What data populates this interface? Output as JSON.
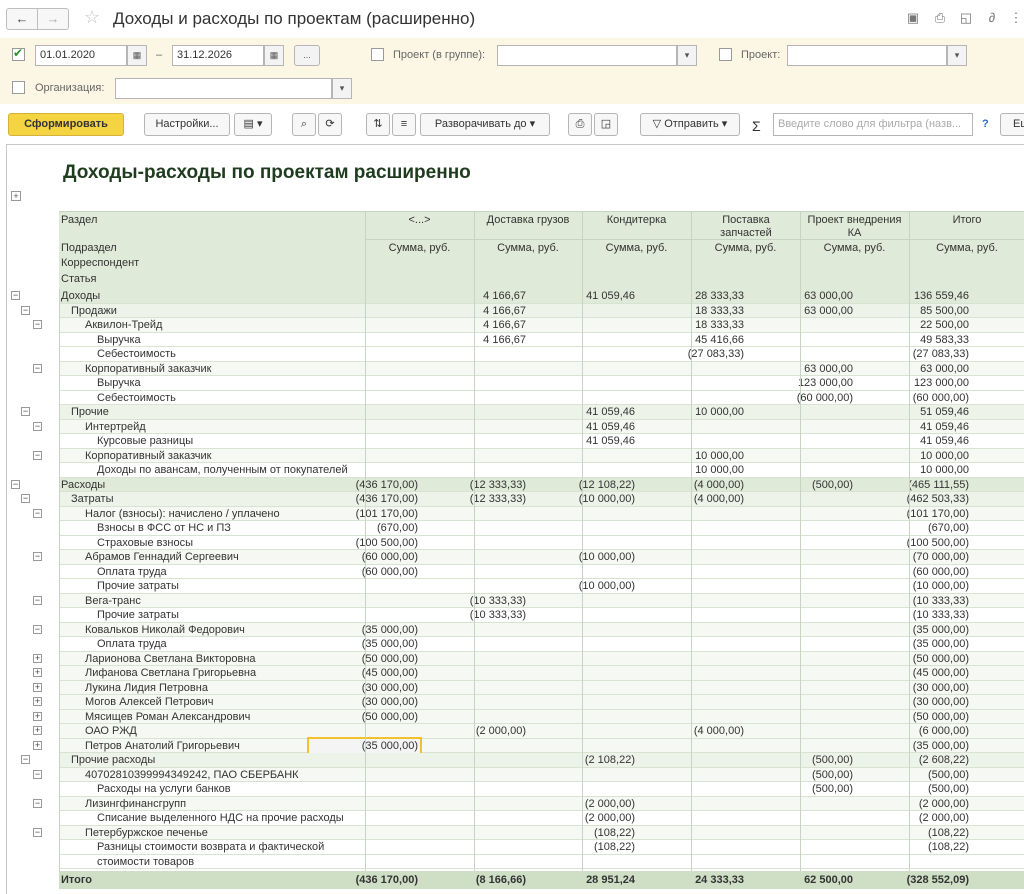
{
  "window": {
    "title": "Доходы и расходы по проектам (расширенно)"
  },
  "filters": {
    "period_from": "01.01.2020",
    "period_sep": "–",
    "period_to": "31.12.2026",
    "more_btn": "...",
    "project_group_label": "Проект (в группе):",
    "project_label": "Проект:",
    "org_label": "Организация:"
  },
  "toolbar": {
    "generate": "Сформировать",
    "settings": "Настройки...",
    "expand_to": "Разворачивать до",
    "send": "Отправить",
    "sigma": "Σ",
    "search_placeholder": "Введите слово для фильтра (назв...",
    "help": "?",
    "more": "Еще"
  },
  "report": {
    "title": "Доходы-расходы по проектам расширенно",
    "headers": {
      "row1": [
        "Раздел",
        "<...>",
        "Доставка грузов",
        "Кондитерка",
        "Поставка запчастей",
        "Проект внедрения КА",
        "Итого"
      ],
      "row2": [
        "Подраздел",
        "Сумма, руб.",
        "Сумма, руб.",
        "Сумма, руб.",
        "Сумма, руб.",
        "Сумма, руб.",
        "Сумма, руб."
      ],
      "row3": "Корреспондент",
      "row4": "Статья"
    },
    "rows": [
      {
        "level": 0,
        "tog": "−",
        "name": "Доходы",
        "v": [
          "",
          "4 166,67",
          "41 059,46",
          "28 333,33",
          "63 000,00",
          "136 559,46"
        ]
      },
      {
        "level": 1,
        "tog": "−",
        "name": "Продажи",
        "v": [
          "",
          "4 166,67",
          "",
          "18 333,33",
          "63 000,00",
          "85 500,00"
        ]
      },
      {
        "level": 2,
        "tog": "−",
        "name": "Аквилон-Трейд",
        "v": [
          "",
          "4 166,67",
          "",
          "18 333,33",
          "",
          "22 500,00"
        ]
      },
      {
        "level": 3,
        "tog": "",
        "name": "Выручка",
        "v": [
          "",
          "4 166,67",
          "",
          "45 416,66",
          "",
          "49 583,33"
        ]
      },
      {
        "level": 3,
        "tog": "",
        "name": "Себестоимость",
        "v": [
          "",
          "",
          "",
          "(27 083,33)",
          "",
          "(27 083,33)"
        ]
      },
      {
        "level": 2,
        "tog": "−",
        "name": "Корпоративный заказчик",
        "v": [
          "",
          "",
          "",
          "",
          "63 000,00",
          "63 000,00"
        ]
      },
      {
        "level": 3,
        "tog": "",
        "name": "Выручка",
        "v": [
          "",
          "",
          "",
          "",
          "123 000,00",
          "123 000,00"
        ]
      },
      {
        "level": 3,
        "tog": "",
        "name": "Себестоимость",
        "v": [
          "",
          "",
          "",
          "",
          "(60 000,00)",
          "(60 000,00)"
        ]
      },
      {
        "level": 1,
        "tog": "−",
        "name": "Прочие",
        "v": [
          "",
          "",
          "41 059,46",
          "10 000,00",
          "",
          "51 059,46"
        ]
      },
      {
        "level": 2,
        "tog": "−",
        "name": "Интертрейд",
        "v": [
          "",
          "",
          "41 059,46",
          "",
          "",
          "41 059,46"
        ]
      },
      {
        "level": 3,
        "tog": "",
        "name": "Курсовые разницы",
        "v": [
          "",
          "",
          "41 059,46",
          "",
          "",
          "41 059,46"
        ]
      },
      {
        "level": 2,
        "tog": "−",
        "name": "Корпоративный заказчик",
        "v": [
          "",
          "",
          "",
          "10 000,00",
          "",
          "10 000,00"
        ]
      },
      {
        "level": 3,
        "tog": "",
        "name": "Доходы по авансам, полученным от покупателей",
        "v": [
          "",
          "",
          "",
          "10 000,00",
          "",
          "10 000,00"
        ]
      },
      {
        "level": 0,
        "tog": "−",
        "name": "Расходы",
        "v": [
          "(436 170,00)",
          "(12 333,33)",
          "(12 108,22)",
          "(4 000,00)",
          "(500,00)",
          "(465 111,55)"
        ]
      },
      {
        "level": 1,
        "tog": "−",
        "name": "Затраты",
        "v": [
          "(436 170,00)",
          "(12 333,33)",
          "(10 000,00)",
          "(4 000,00)",
          "",
          "(462 503,33)"
        ]
      },
      {
        "level": 2,
        "tog": "−",
        "name": "Налог (взносы): начислено / уплачено",
        "v": [
          "(101 170,00)",
          "",
          "",
          "",
          "",
          "(101 170,00)"
        ]
      },
      {
        "level": 3,
        "tog": "",
        "name": "Взносы в ФСС от НС и ПЗ",
        "v": [
          "(670,00)",
          "",
          "",
          "",
          "",
          "(670,00)"
        ]
      },
      {
        "level": 3,
        "tog": "",
        "name": "Страховые взносы",
        "v": [
          "(100 500,00)",
          "",
          "",
          "",
          "",
          "(100 500,00)"
        ]
      },
      {
        "level": 2,
        "tog": "−",
        "name": "Абрамов Геннадий Сергеевич",
        "v": [
          "(60 000,00)",
          "",
          "(10 000,00)",
          "",
          "",
          "(70 000,00)"
        ]
      },
      {
        "level": 3,
        "tog": "",
        "name": "Оплата труда",
        "v": [
          "(60 000,00)",
          "",
          "",
          "",
          "",
          "(60 000,00)"
        ]
      },
      {
        "level": 3,
        "tog": "",
        "name": "Прочие затраты",
        "v": [
          "",
          "",
          "(10 000,00)",
          "",
          "",
          "(10 000,00)"
        ]
      },
      {
        "level": 2,
        "tog": "−",
        "name": "Вега-транс",
        "v": [
          "",
          "(10 333,33)",
          "",
          "",
          "",
          "(10 333,33)"
        ]
      },
      {
        "level": 3,
        "tog": "",
        "name": "Прочие затраты",
        "v": [
          "",
          "(10 333,33)",
          "",
          "",
          "",
          "(10 333,33)"
        ]
      },
      {
        "level": 2,
        "tog": "−",
        "name": "Ковальков Николай Федорович",
        "v": [
          "(35 000,00)",
          "",
          "",
          "",
          "",
          "(35 000,00)"
        ]
      },
      {
        "level": 3,
        "tog": "",
        "name": "Оплата труда",
        "v": [
          "(35 000,00)",
          "",
          "",
          "",
          "",
          "(35 000,00)"
        ]
      },
      {
        "level": 2,
        "tog": "+",
        "name": "Ларионова Светлана Викторовна",
        "v": [
          "(50 000,00)",
          "",
          "",
          "",
          "",
          "(50 000,00)"
        ]
      },
      {
        "level": 2,
        "tog": "+",
        "name": "Лифанова Светлана Григорьевна",
        "v": [
          "(45 000,00)",
          "",
          "",
          "",
          "",
          "(45 000,00)"
        ]
      },
      {
        "level": 2,
        "tog": "+",
        "name": "Лукина Лидия Петровна",
        "v": [
          "(30 000,00)",
          "",
          "",
          "",
          "",
          "(30 000,00)"
        ]
      },
      {
        "level": 2,
        "tog": "+",
        "name": "Могов Алексей Петрович",
        "v": [
          "(30 000,00)",
          "",
          "",
          "",
          "",
          "(30 000,00)"
        ]
      },
      {
        "level": 2,
        "tog": "+",
        "name": "Мясищев Роман Александрович",
        "v": [
          "(50 000,00)",
          "",
          "",
          "",
          "",
          "(50 000,00)"
        ]
      },
      {
        "level": 2,
        "tog": "+",
        "name": "ОАО РЖД",
        "v": [
          "",
          "(2 000,00)",
          "",
          "(4 000,00)",
          "",
          "(6 000,00)"
        ]
      },
      {
        "level": 2,
        "tog": "+",
        "name": "Петров Анатолий Григорьевич",
        "v": [
          "(35 000,00)",
          "",
          "",
          "",
          "",
          "(35 000,00)"
        ],
        "selected": 0
      },
      {
        "level": 1,
        "tog": "−",
        "name": "Прочие расходы",
        "v": [
          "",
          "",
          "(2 108,22)",
          "",
          "(500,00)",
          "(2 608,22)"
        ]
      },
      {
        "level": 2,
        "tog": "−",
        "name": "40702810399994349242, ПАО СБЕРБАНК",
        "v": [
          "",
          "",
          "",
          "",
          "(500,00)",
          "(500,00)"
        ]
      },
      {
        "level": 3,
        "tog": "",
        "name": "Расходы на услуги банков",
        "v": [
          "",
          "",
          "",
          "",
          "(500,00)",
          "(500,00)"
        ]
      },
      {
        "level": 2,
        "tog": "−",
        "name": "Лизингфинансгрупп",
        "v": [
          "",
          "",
          "(2 000,00)",
          "",
          "",
          "(2 000,00)"
        ]
      },
      {
        "level": 3,
        "tog": "",
        "name": "Списание выделенного НДС на прочие расходы",
        "v": [
          "",
          "",
          "(2 000,00)",
          "",
          "",
          "(2 000,00)"
        ]
      },
      {
        "level": 2,
        "tog": "−",
        "name": "Петербуржское печенье",
        "v": [
          "",
          "",
          "(108,22)",
          "",
          "",
          "(108,22)"
        ]
      },
      {
        "level": 3,
        "tog": "",
        "name": "Разницы стоимости возврата и фактической",
        "v": [
          "",
          "",
          "(108,22)",
          "",
          "",
          "(108,22)"
        ]
      },
      {
        "level": 3,
        "tog": "",
        "name": "стоимости товаров",
        "v": [
          "",
          "",
          "",
          "",
          "",
          ""
        ]
      }
    ],
    "total": {
      "name": "Итого",
      "v": [
        "(436 170,00)",
        "(8 166,66)",
        "28 951,24",
        "24 333,33",
        "62 500,00",
        "(328 552,09)"
      ]
    }
  }
}
